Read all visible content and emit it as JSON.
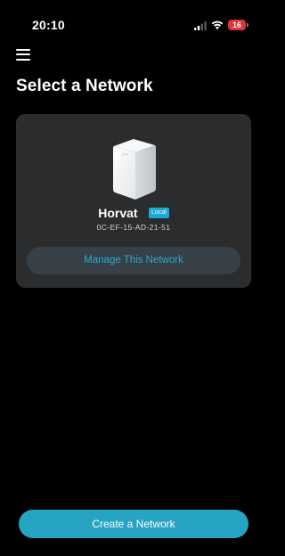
{
  "status_bar": {
    "time": "20:10",
    "battery_level": "16",
    "signal_icon": "cellular-signal-icon",
    "wifi_icon": "wifi-icon",
    "battery_color": "#e0323a"
  },
  "header": {
    "menu_icon": "hamburger-menu-icon",
    "title": "Select a Network"
  },
  "networks": [
    {
      "name": "Horvat",
      "badge": "Local",
      "mac": "0C-EF-15-AD-21-51",
      "device_icon": "mesh-router-device-image",
      "manage_label": "Manage This Network"
    }
  ],
  "footer": {
    "create_label": "Create a Network"
  },
  "colors": {
    "background": "#000000",
    "card": "#2b2c2e",
    "accent": "#27a4c2",
    "badge": "#19a8d8",
    "manage_button_bg": "#364046",
    "manage_button_text": "#31a8c7"
  }
}
